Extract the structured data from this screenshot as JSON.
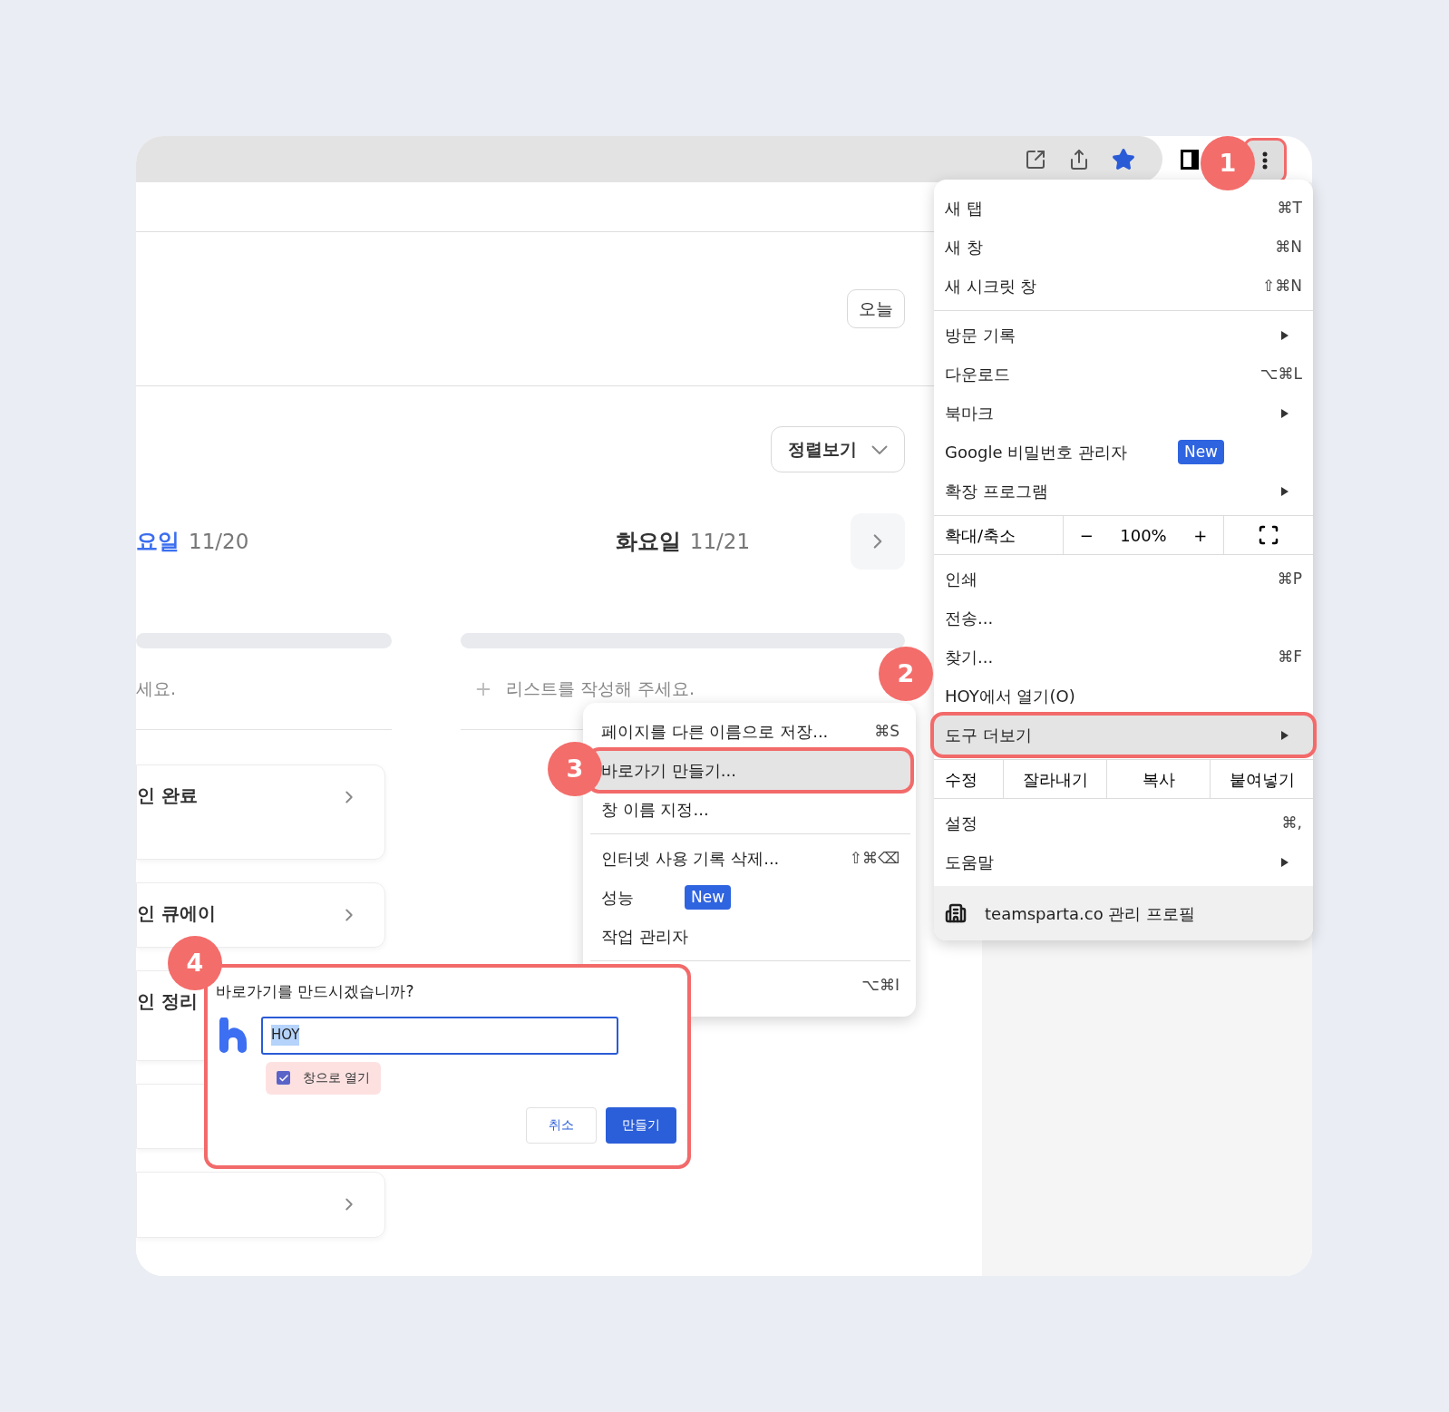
{
  "page": {
    "today_button": "오늘",
    "sort_dropdown": "정렬보기",
    "days": [
      {
        "day": "요일",
        "date": "11/20",
        "selected": true
      },
      {
        "day": "화요일",
        "date": "11/21",
        "selected": false
      }
    ],
    "add_prompts": [
      "세요.",
      "리스트를 작성해 주세요."
    ],
    "cards": [
      {
        "kind": "titled",
        "title": "인 완료",
        "arrow": true
      },
      {
        "kind": "titled",
        "title": "인 큐에이",
        "arrow": true
      },
      {
        "kind": "titled",
        "title": "인 정리"
      },
      {
        "kind": "blank"
      },
      {
        "kind": "blank",
        "arrow": true
      }
    ]
  },
  "main_menu": {
    "sections": [
      [
        {
          "kind": "item",
          "label": "새 탭",
          "shortcut": "⌘T",
          "selected": false
        },
        {
          "kind": "item",
          "label": "새 창",
          "shortcut": "⌘N",
          "selected": false
        },
        {
          "kind": "item",
          "label": "새 시크릿 창",
          "shortcut": "⇧⌘N",
          "selected": false
        }
      ],
      [
        {
          "kind": "item",
          "label": "방문 기록",
          "submenu": true,
          "selected": false
        },
        {
          "kind": "item",
          "label": "다운로드",
          "shortcut": "⌥⌘L",
          "selected": false
        },
        {
          "kind": "item",
          "label": "북마크",
          "submenu": true,
          "selected": false
        },
        {
          "kind": "item",
          "label": "Google 비밀번호 관리자",
          "badge": "New",
          "selected": false
        },
        {
          "kind": "item",
          "label": "확장 프로그램",
          "submenu": true,
          "selected": false
        }
      ],
      [
        {
          "kind": "zoom",
          "label": "확대/축소",
          "minus": "−",
          "value": "100%",
          "plus": "+"
        }
      ],
      [
        {
          "kind": "item",
          "label": "인쇄",
          "shortcut": "⌘P",
          "selected": false
        },
        {
          "kind": "item",
          "label": "전송...",
          "selected": false
        },
        {
          "kind": "item",
          "label": "찾기...",
          "shortcut": "⌘F",
          "selected": false
        },
        {
          "kind": "item",
          "label": "HOY에서 열기(O)",
          "selected": false
        },
        {
          "kind": "item",
          "label": "도구 더보기",
          "submenu": true,
          "selected": true
        }
      ],
      [
        {
          "kind": "edit",
          "label": "수정",
          "actions": [
            "잘라내기",
            "복사",
            "붙여넣기"
          ]
        }
      ],
      [
        {
          "kind": "item",
          "label": "설정",
          "shortcut": "⌘,",
          "selected": false
        },
        {
          "kind": "item",
          "label": "도움말",
          "submenu": true,
          "selected": false
        }
      ],
      [
        {
          "kind": "profile",
          "label": "teamsparta.co 관리 프로필"
        }
      ]
    ]
  },
  "sub_menu": {
    "sections": [
      [
        {
          "kind": "item",
          "label": "페이지를 다른 이름으로 저장...",
          "shortcut": "⌘S",
          "selected": false
        },
        {
          "kind": "item",
          "label": "바로가기 만들기...",
          "selected": true
        },
        {
          "kind": "item",
          "label": "창 이름 지정...",
          "selected": false
        }
      ],
      [
        {
          "kind": "item",
          "label": "인터넷 사용 기록 삭제...",
          "shortcut": "⇧⌘⌫",
          "selected": false
        },
        {
          "kind": "item",
          "label": "성능",
          "badge": "New",
          "selected": false
        },
        {
          "kind": "item",
          "label": "작업 관리자",
          "selected": false
        }
      ],
      [
        {
          "kind": "item",
          "shortcut": "⌥⌘I",
          "selected": false
        }
      ]
    ]
  },
  "dialog": {
    "title": "바로가기를 만드시겠습니까?",
    "name_field": {
      "value": "HOY",
      "text_selected": true
    },
    "checkbox": {
      "label": "창으로 열기",
      "checked": true,
      "highlighted": true
    },
    "buttons": [
      {
        "label": "취소",
        "kind": "secondary"
      },
      {
        "label": "만들기",
        "kind": "primary"
      }
    ]
  },
  "annotations": [
    "1",
    "2",
    "3",
    "4"
  ]
}
